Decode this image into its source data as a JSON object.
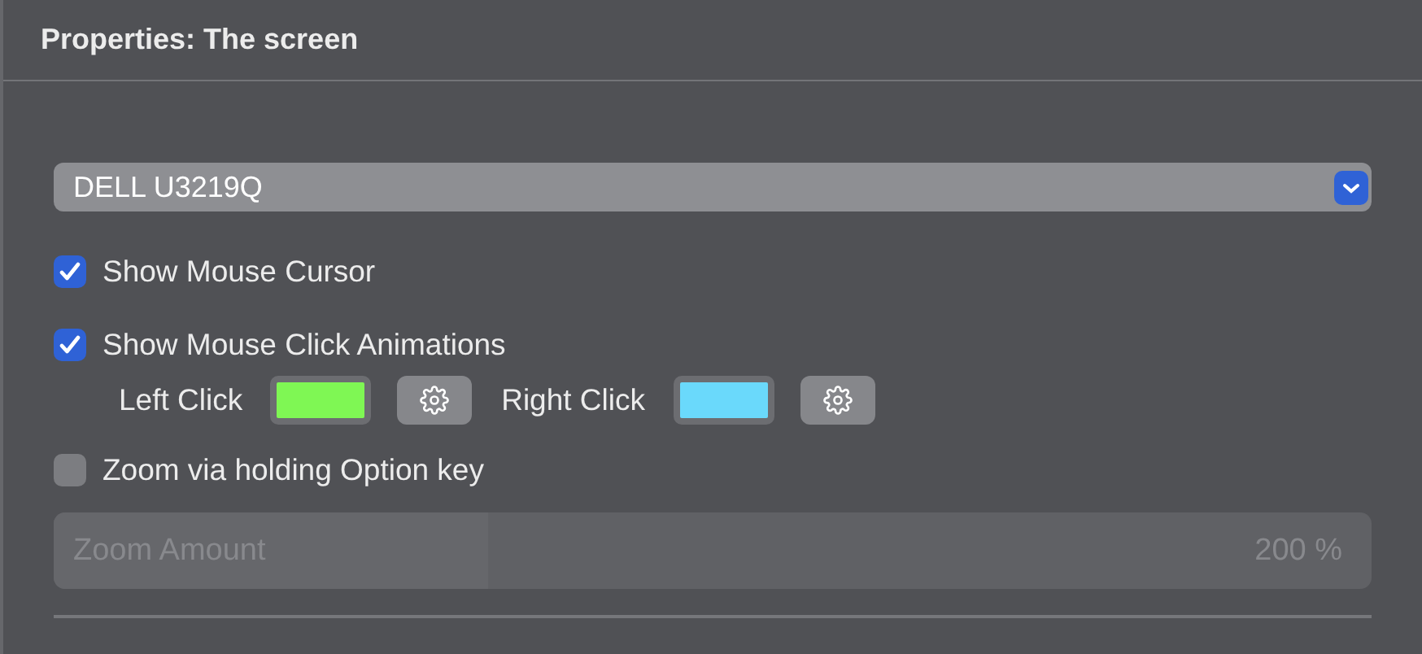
{
  "panel": {
    "title": "Properties: The screen"
  },
  "display_popup": {
    "value": "DELL U3219Q"
  },
  "options": [
    {
      "kind": "checkbox",
      "label": "Show Mouse Cursor",
      "checked": true
    },
    {
      "kind": "checkbox",
      "label": "Show Mouse Click Animations",
      "checked": true
    },
    {
      "kind": "colors",
      "items": [
        {
          "label": "Left Click",
          "color": "#7ff754"
        },
        {
          "label": "Right Click",
          "color": "#6ad9fb"
        }
      ]
    },
    {
      "kind": "checkbox",
      "label": "Zoom via holding Option key",
      "checked": false
    }
  ],
  "zoom_slider": {
    "label": "Zoom Amount",
    "reading": "200 %",
    "level": 0.33,
    "disabled": true
  }
}
